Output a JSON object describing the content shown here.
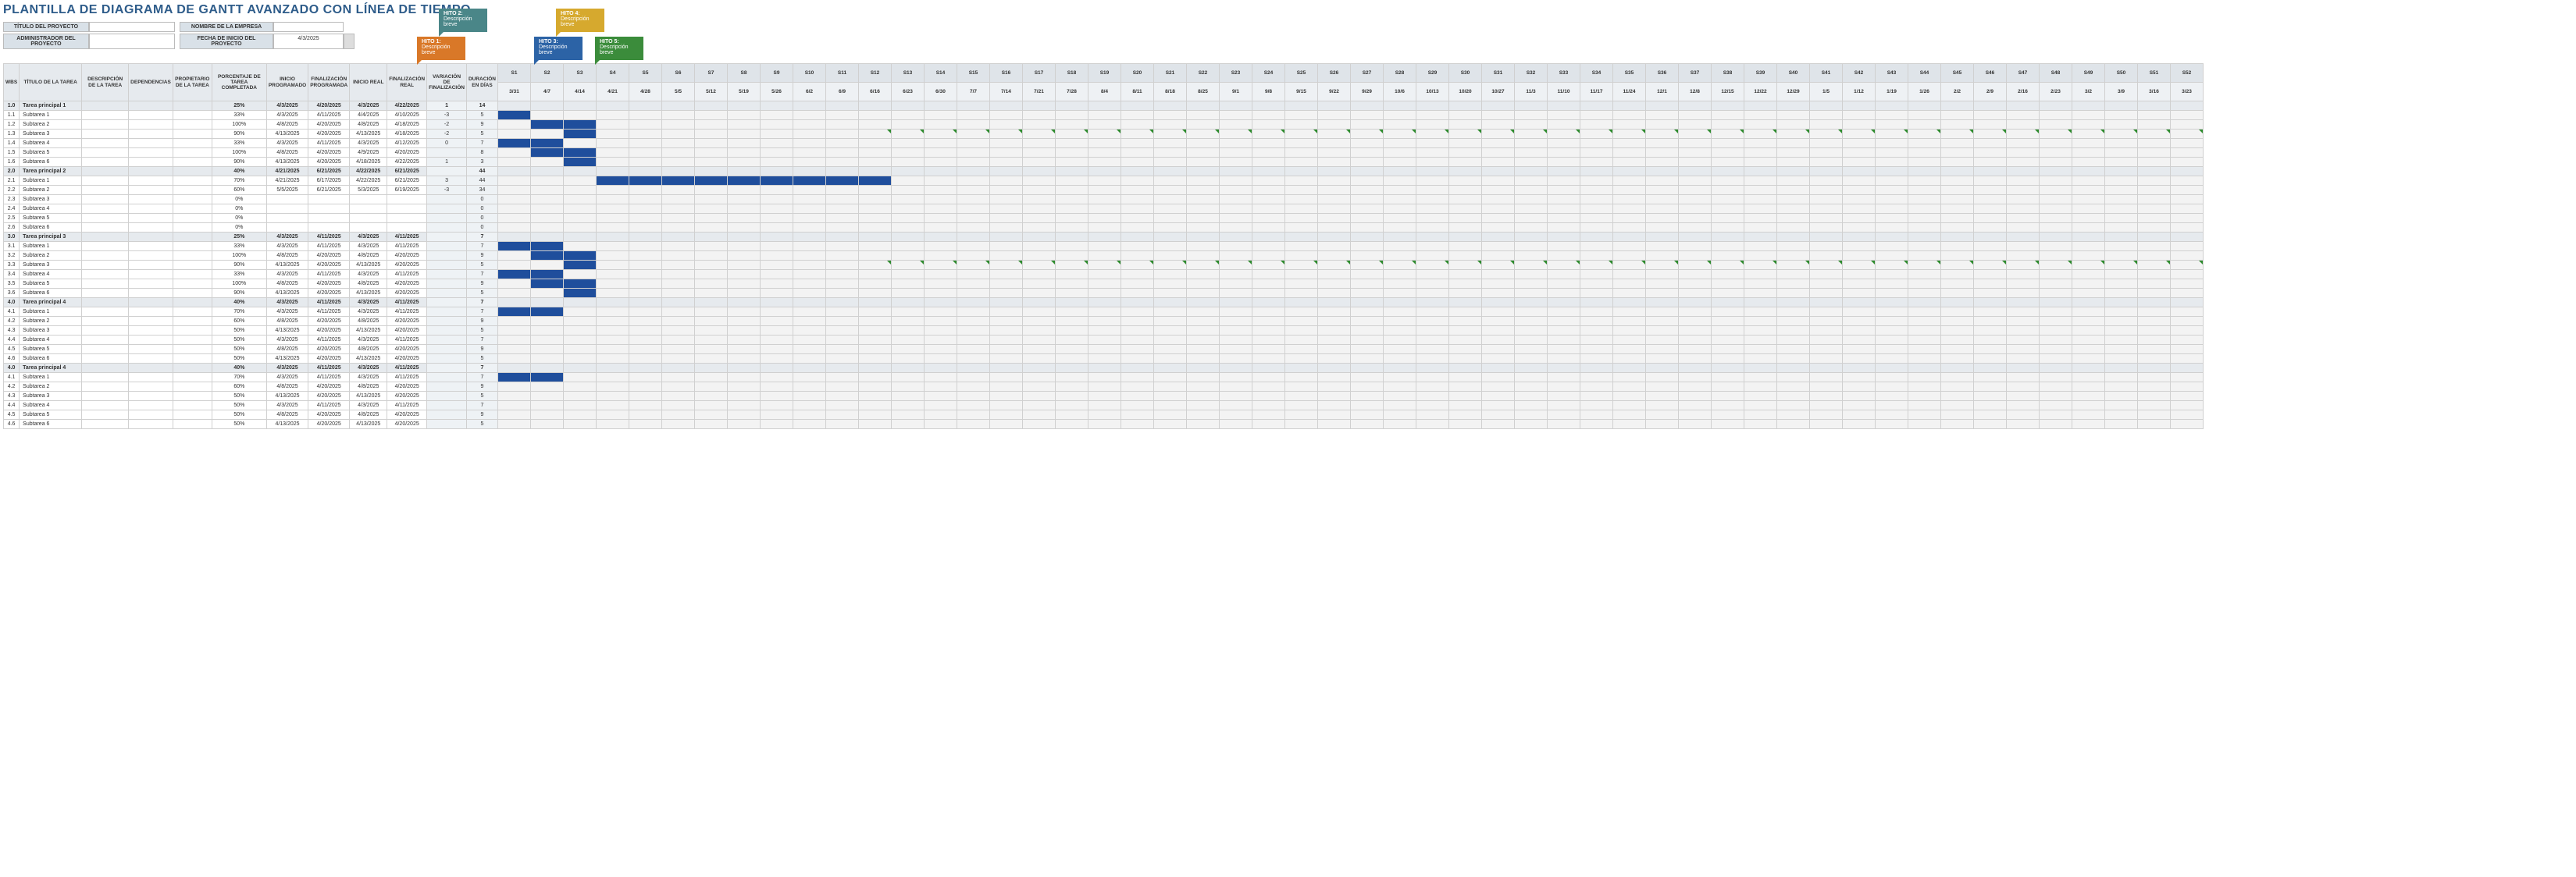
{
  "title": "PLANTILLA DE DIAGRAMA DE GANTT AVANZADO CON LÍNEA DE TIEMPO",
  "meta": {
    "project_title_label": "TÍTULO DEL PROYECTO",
    "project_title": "",
    "company_label": "NOMBRE DE LA EMPRESA",
    "company": "",
    "admin_label": "ADMINISTRADOR DEL PROYECTO",
    "admin": "",
    "start_label": "FECHA DE INICIO DEL PROYECTO",
    "start": "4/3/2025"
  },
  "flags": [
    {
      "cls": "orange",
      "t": "HITO 1:",
      "d": "Descripción breve"
    },
    {
      "cls": "teal",
      "t": "HITO 2:",
      "d": "Descripción breve"
    },
    {
      "cls": "blue",
      "t": "HITO 3:",
      "d": "Descripción breve"
    },
    {
      "cls": "olive",
      "t": "HITO 4:",
      "d": "Descripción breve"
    },
    {
      "cls": "green",
      "t": "HITO 5:",
      "d": "Descripción breve"
    }
  ],
  "headers": {
    "wbs": "WBS",
    "title": "TÍTULO DE LA TAREA",
    "desc": "DESCRIPCIÓN DE LA TAREA",
    "dep": "DEPENDENCIAS",
    "own": "PROPIETARIO DE LA TAREA",
    "pct": "PORCENTAJE DE TAREA COMPLETADA",
    "pstart": "INICIO PROGRAMADO",
    "pend": "FINALIZACIÓN PROGRAMADA",
    "astart": "INICIO REAL",
    "aend": "FINALIZACIÓN REAL",
    "var": "VARIACIÓN DE FINALIZACIÓN",
    "dur": "DURACIÓN EN DÍAS"
  },
  "weeks": [
    "S1",
    "S2",
    "S3",
    "S4",
    "S5",
    "S6",
    "S7",
    "S8",
    "S9",
    "S10",
    "S11",
    "S12",
    "S13",
    "S14",
    "S15",
    "S16",
    "S17",
    "S18",
    "S19",
    "S20",
    "S21",
    "S22",
    "S23",
    "S24",
    "S25",
    "S26",
    "S27",
    "S28",
    "S29",
    "S30",
    "S31",
    "S32",
    "S33",
    "S34",
    "S35",
    "S36",
    "S37",
    "S38",
    "S39",
    "S40",
    "S41",
    "S42",
    "S43",
    "S44",
    "S45",
    "S46",
    "S47",
    "S48",
    "S49",
    "S50",
    "S51",
    "S52"
  ],
  "days": [
    "3/31",
    "4/7",
    "4/14",
    "4/21",
    "4/28",
    "5/5",
    "5/12",
    "5/19",
    "5/26",
    "6/2",
    "6/9",
    "6/16",
    "6/23",
    "6/30",
    "7/7",
    "7/14",
    "7/21",
    "7/28",
    "8/4",
    "8/11",
    "8/18",
    "8/25",
    "9/1",
    "9/8",
    "9/15",
    "9/22",
    "9/29",
    "10/6",
    "10/13",
    "10/20",
    "10/27",
    "11/3",
    "11/10",
    "11/17",
    "11/24",
    "12/1",
    "12/8",
    "12/15",
    "12/22",
    "12/29",
    "1/5",
    "1/12",
    "1/19",
    "1/26",
    "2/2",
    "2/9",
    "2/16",
    "2/23",
    "3/2",
    "3/9",
    "3/16",
    "3/23"
  ],
  "chart_data": {
    "type": "gantt",
    "rows": [
      {
        "wbs": "1.0",
        "title": "Tarea principal 1",
        "pct": "25%",
        "ps": "4/3/2025",
        "pe": "4/20/2025",
        "as": "4/3/2025",
        "ae": "4/22/2025",
        "var": "1",
        "dur": "14",
        "section": true,
        "bar": [
          0,
          1
        ]
      },
      {
        "wbs": "1.1",
        "title": "Subtarea 1",
        "pct": "33%",
        "ps": "4/3/2025",
        "pe": "4/11/2025",
        "as": "4/4/2025",
        "ae": "4/10/2025",
        "var": "-3",
        "dur": "5",
        "bar": [
          0
        ]
      },
      {
        "wbs": "1.2",
        "title": "Subtarea 2",
        "pct": "100%",
        "ps": "4/8/2025",
        "pe": "4/20/2025",
        "as": "4/8/2025",
        "ae": "4/18/2025",
        "var": "-2",
        "dur": "9",
        "bar": [
          1,
          2
        ]
      },
      {
        "wbs": "1.3",
        "title": "Subtarea 3",
        "pct": "90%",
        "ps": "4/13/2025",
        "pe": "4/20/2025",
        "as": "4/13/2025",
        "ae": "4/18/2025",
        "var": "-2",
        "dur": "5",
        "bar": [
          2
        ],
        "ticks": true
      },
      {
        "wbs": "1.4",
        "title": "Subtarea 4",
        "pct": "33%",
        "ps": "4/3/2025",
        "pe": "4/11/2025",
        "as": "4/3/2025",
        "ae": "4/12/2025",
        "var": "0",
        "dur": "7",
        "bar": [
          0,
          1
        ]
      },
      {
        "wbs": "1.5",
        "title": "Subtarea 5",
        "pct": "100%",
        "ps": "4/8/2025",
        "pe": "4/20/2025",
        "as": "4/9/2025",
        "ae": "4/20/2025",
        "var": "",
        "dur": "8",
        "bar": [
          1,
          2
        ]
      },
      {
        "wbs": "1.6",
        "title": "Subtarea 6",
        "pct": "90%",
        "ps": "4/13/2025",
        "pe": "4/20/2025",
        "as": "4/18/2025",
        "ae": "4/22/2025",
        "var": "1",
        "dur": "3",
        "bar": [
          2
        ]
      },
      {
        "wbs": "2.0",
        "title": "Tarea principal 2",
        "pct": "40%",
        "ps": "4/21/2025",
        "pe": "6/21/2025",
        "as": "4/22/2025",
        "ae": "6/21/2025",
        "var": "",
        "dur": "44",
        "section": true,
        "bar": [
          3,
          4,
          5,
          6,
          7,
          8,
          9,
          10,
          11
        ]
      },
      {
        "wbs": "2.1",
        "title": "Subtarea 1",
        "pct": "70%",
        "ps": "4/21/2025",
        "pe": "6/17/2025",
        "as": "4/22/2025",
        "ae": "6/21/2025",
        "var": "3",
        "dur": "44",
        "bar": [
          3,
          4,
          5,
          6,
          7,
          8,
          9,
          10,
          11
        ]
      },
      {
        "wbs": "2.2",
        "title": "Subtarea 2",
        "pct": "60%",
        "ps": "5/5/2025",
        "pe": "6/21/2025",
        "as": "5/3/2025",
        "ae": "6/19/2025",
        "var": "-3",
        "dur": "34",
        "bar": []
      },
      {
        "wbs": "2.3",
        "title": "Subtarea 3",
        "pct": "0%",
        "ps": "",
        "pe": "",
        "as": "",
        "ae": "",
        "var": "",
        "dur": "0",
        "bar": []
      },
      {
        "wbs": "2.4",
        "title": "Subtarea 4",
        "pct": "0%",
        "ps": "",
        "pe": "",
        "as": "",
        "ae": "",
        "var": "",
        "dur": "0",
        "bar": []
      },
      {
        "wbs": "2.5",
        "title": "Subtarea 5",
        "pct": "0%",
        "ps": "",
        "pe": "",
        "as": "",
        "ae": "",
        "var": "",
        "dur": "0",
        "bar": []
      },
      {
        "wbs": "2.6",
        "title": "Subtarea 6",
        "pct": "0%",
        "ps": "",
        "pe": "",
        "as": "",
        "ae": "",
        "var": "",
        "dur": "0",
        "bar": []
      },
      {
        "wbs": "3.0",
        "title": "Tarea principal 3",
        "pct": "25%",
        "ps": "4/3/2025",
        "pe": "4/11/2025",
        "as": "4/3/2025",
        "ae": "4/11/2025",
        "var": "",
        "dur": "7",
        "section": true,
        "bar": [
          0,
          1
        ]
      },
      {
        "wbs": "3.1",
        "title": "Subtarea 1",
        "pct": "33%",
        "ps": "4/3/2025",
        "pe": "4/11/2025",
        "as": "4/3/2025",
        "ae": "4/11/2025",
        "var": "",
        "dur": "7",
        "bar": [
          0,
          1
        ]
      },
      {
        "wbs": "3.2",
        "title": "Subtarea 2",
        "pct": "100%",
        "ps": "4/8/2025",
        "pe": "4/20/2025",
        "as": "4/8/2025",
        "ae": "4/20/2025",
        "var": "",
        "dur": "9",
        "bar": [
          1,
          2
        ]
      },
      {
        "wbs": "3.3",
        "title": "Subtarea 3",
        "pct": "90%",
        "ps": "4/13/2025",
        "pe": "4/20/2025",
        "as": "4/13/2025",
        "ae": "4/20/2025",
        "var": "",
        "dur": "5",
        "bar": [
          2
        ],
        "ticks": true
      },
      {
        "wbs": "3.4",
        "title": "Subtarea 4",
        "pct": "33%",
        "ps": "4/3/2025",
        "pe": "4/11/2025",
        "as": "4/3/2025",
        "ae": "4/11/2025",
        "var": "",
        "dur": "7",
        "bar": [
          0,
          1
        ]
      },
      {
        "wbs": "3.5",
        "title": "Subtarea 5",
        "pct": "100%",
        "ps": "4/8/2025",
        "pe": "4/20/2025",
        "as": "4/8/2025",
        "ae": "4/20/2025",
        "var": "",
        "dur": "9",
        "bar": [
          1,
          2
        ]
      },
      {
        "wbs": "3.6",
        "title": "Subtarea 6",
        "pct": "90%",
        "ps": "4/13/2025",
        "pe": "4/20/2025",
        "as": "4/13/2025",
        "ae": "4/20/2025",
        "var": "",
        "dur": "5",
        "bar": [
          2
        ]
      },
      {
        "wbs": "4.0",
        "title": "Tarea principal 4",
        "pct": "40%",
        "ps": "4/3/2025",
        "pe": "4/11/2025",
        "as": "4/3/2025",
        "ae": "4/11/2025",
        "var": "",
        "dur": "7",
        "section": true,
        "bar": [
          0,
          1
        ]
      },
      {
        "wbs": "4.1",
        "title": "Subtarea 1",
        "pct": "70%",
        "ps": "4/3/2025",
        "pe": "4/11/2025",
        "as": "4/3/2025",
        "ae": "4/11/2025",
        "var": "",
        "dur": "7",
        "bar": [
          0,
          1
        ]
      },
      {
        "wbs": "4.2",
        "title": "Subtarea 2",
        "pct": "60%",
        "ps": "4/8/2025",
        "pe": "4/20/2025",
        "as": "4/8/2025",
        "ae": "4/20/2025",
        "var": "",
        "dur": "9",
        "bar": []
      },
      {
        "wbs": "4.3",
        "title": "Subtarea 3",
        "pct": "50%",
        "ps": "4/13/2025",
        "pe": "4/20/2025",
        "as": "4/13/2025",
        "ae": "4/20/2025",
        "var": "",
        "dur": "5",
        "bar": []
      },
      {
        "wbs": "4.4",
        "title": "Subtarea 4",
        "pct": "50%",
        "ps": "4/3/2025",
        "pe": "4/11/2025",
        "as": "4/3/2025",
        "ae": "4/11/2025",
        "var": "",
        "dur": "7",
        "bar": []
      },
      {
        "wbs": "4.5",
        "title": "Subtarea 5",
        "pct": "50%",
        "ps": "4/8/2025",
        "pe": "4/20/2025",
        "as": "4/8/2025",
        "ae": "4/20/2025",
        "var": "",
        "dur": "9",
        "bar": []
      },
      {
        "wbs": "4.6",
        "title": "Subtarea 6",
        "pct": "50%",
        "ps": "4/13/2025",
        "pe": "4/20/2025",
        "as": "4/13/2025",
        "ae": "4/20/2025",
        "var": "",
        "dur": "5",
        "bar": []
      },
      {
        "wbs": "4.0",
        "title": "Tarea principal 4",
        "pct": "40%",
        "ps": "4/3/2025",
        "pe": "4/11/2025",
        "as": "4/3/2025",
        "ae": "4/11/2025",
        "var": "",
        "dur": "7",
        "section": true,
        "bar": [
          0,
          1
        ]
      },
      {
        "wbs": "4.1",
        "title": "Subtarea 1",
        "pct": "70%",
        "ps": "4/3/2025",
        "pe": "4/11/2025",
        "as": "4/3/2025",
        "ae": "4/11/2025",
        "var": "",
        "dur": "7",
        "bar": [
          0,
          1
        ]
      },
      {
        "wbs": "4.2",
        "title": "Subtarea 2",
        "pct": "60%",
        "ps": "4/8/2025",
        "pe": "4/20/2025",
        "as": "4/8/2025",
        "ae": "4/20/2025",
        "var": "",
        "dur": "9",
        "bar": []
      },
      {
        "wbs": "4.3",
        "title": "Subtarea 3",
        "pct": "50%",
        "ps": "4/13/2025",
        "pe": "4/20/2025",
        "as": "4/13/2025",
        "ae": "4/20/2025",
        "var": "",
        "dur": "5",
        "bar": []
      },
      {
        "wbs": "4.4",
        "title": "Subtarea 4",
        "pct": "50%",
        "ps": "4/3/2025",
        "pe": "4/11/2025",
        "as": "4/3/2025",
        "ae": "4/11/2025",
        "var": "",
        "dur": "7",
        "bar": []
      },
      {
        "wbs": "4.5",
        "title": "Subtarea 5",
        "pct": "50%",
        "ps": "4/8/2025",
        "pe": "4/20/2025",
        "as": "4/8/2025",
        "ae": "4/20/2025",
        "var": "",
        "dur": "9",
        "bar": []
      },
      {
        "wbs": "4.6",
        "title": "Subtarea 6",
        "pct": "50%",
        "ps": "4/13/2025",
        "pe": "4/20/2025",
        "as": "4/13/2025",
        "ae": "4/20/2025",
        "var": "",
        "dur": "5",
        "bar": []
      }
    ]
  }
}
